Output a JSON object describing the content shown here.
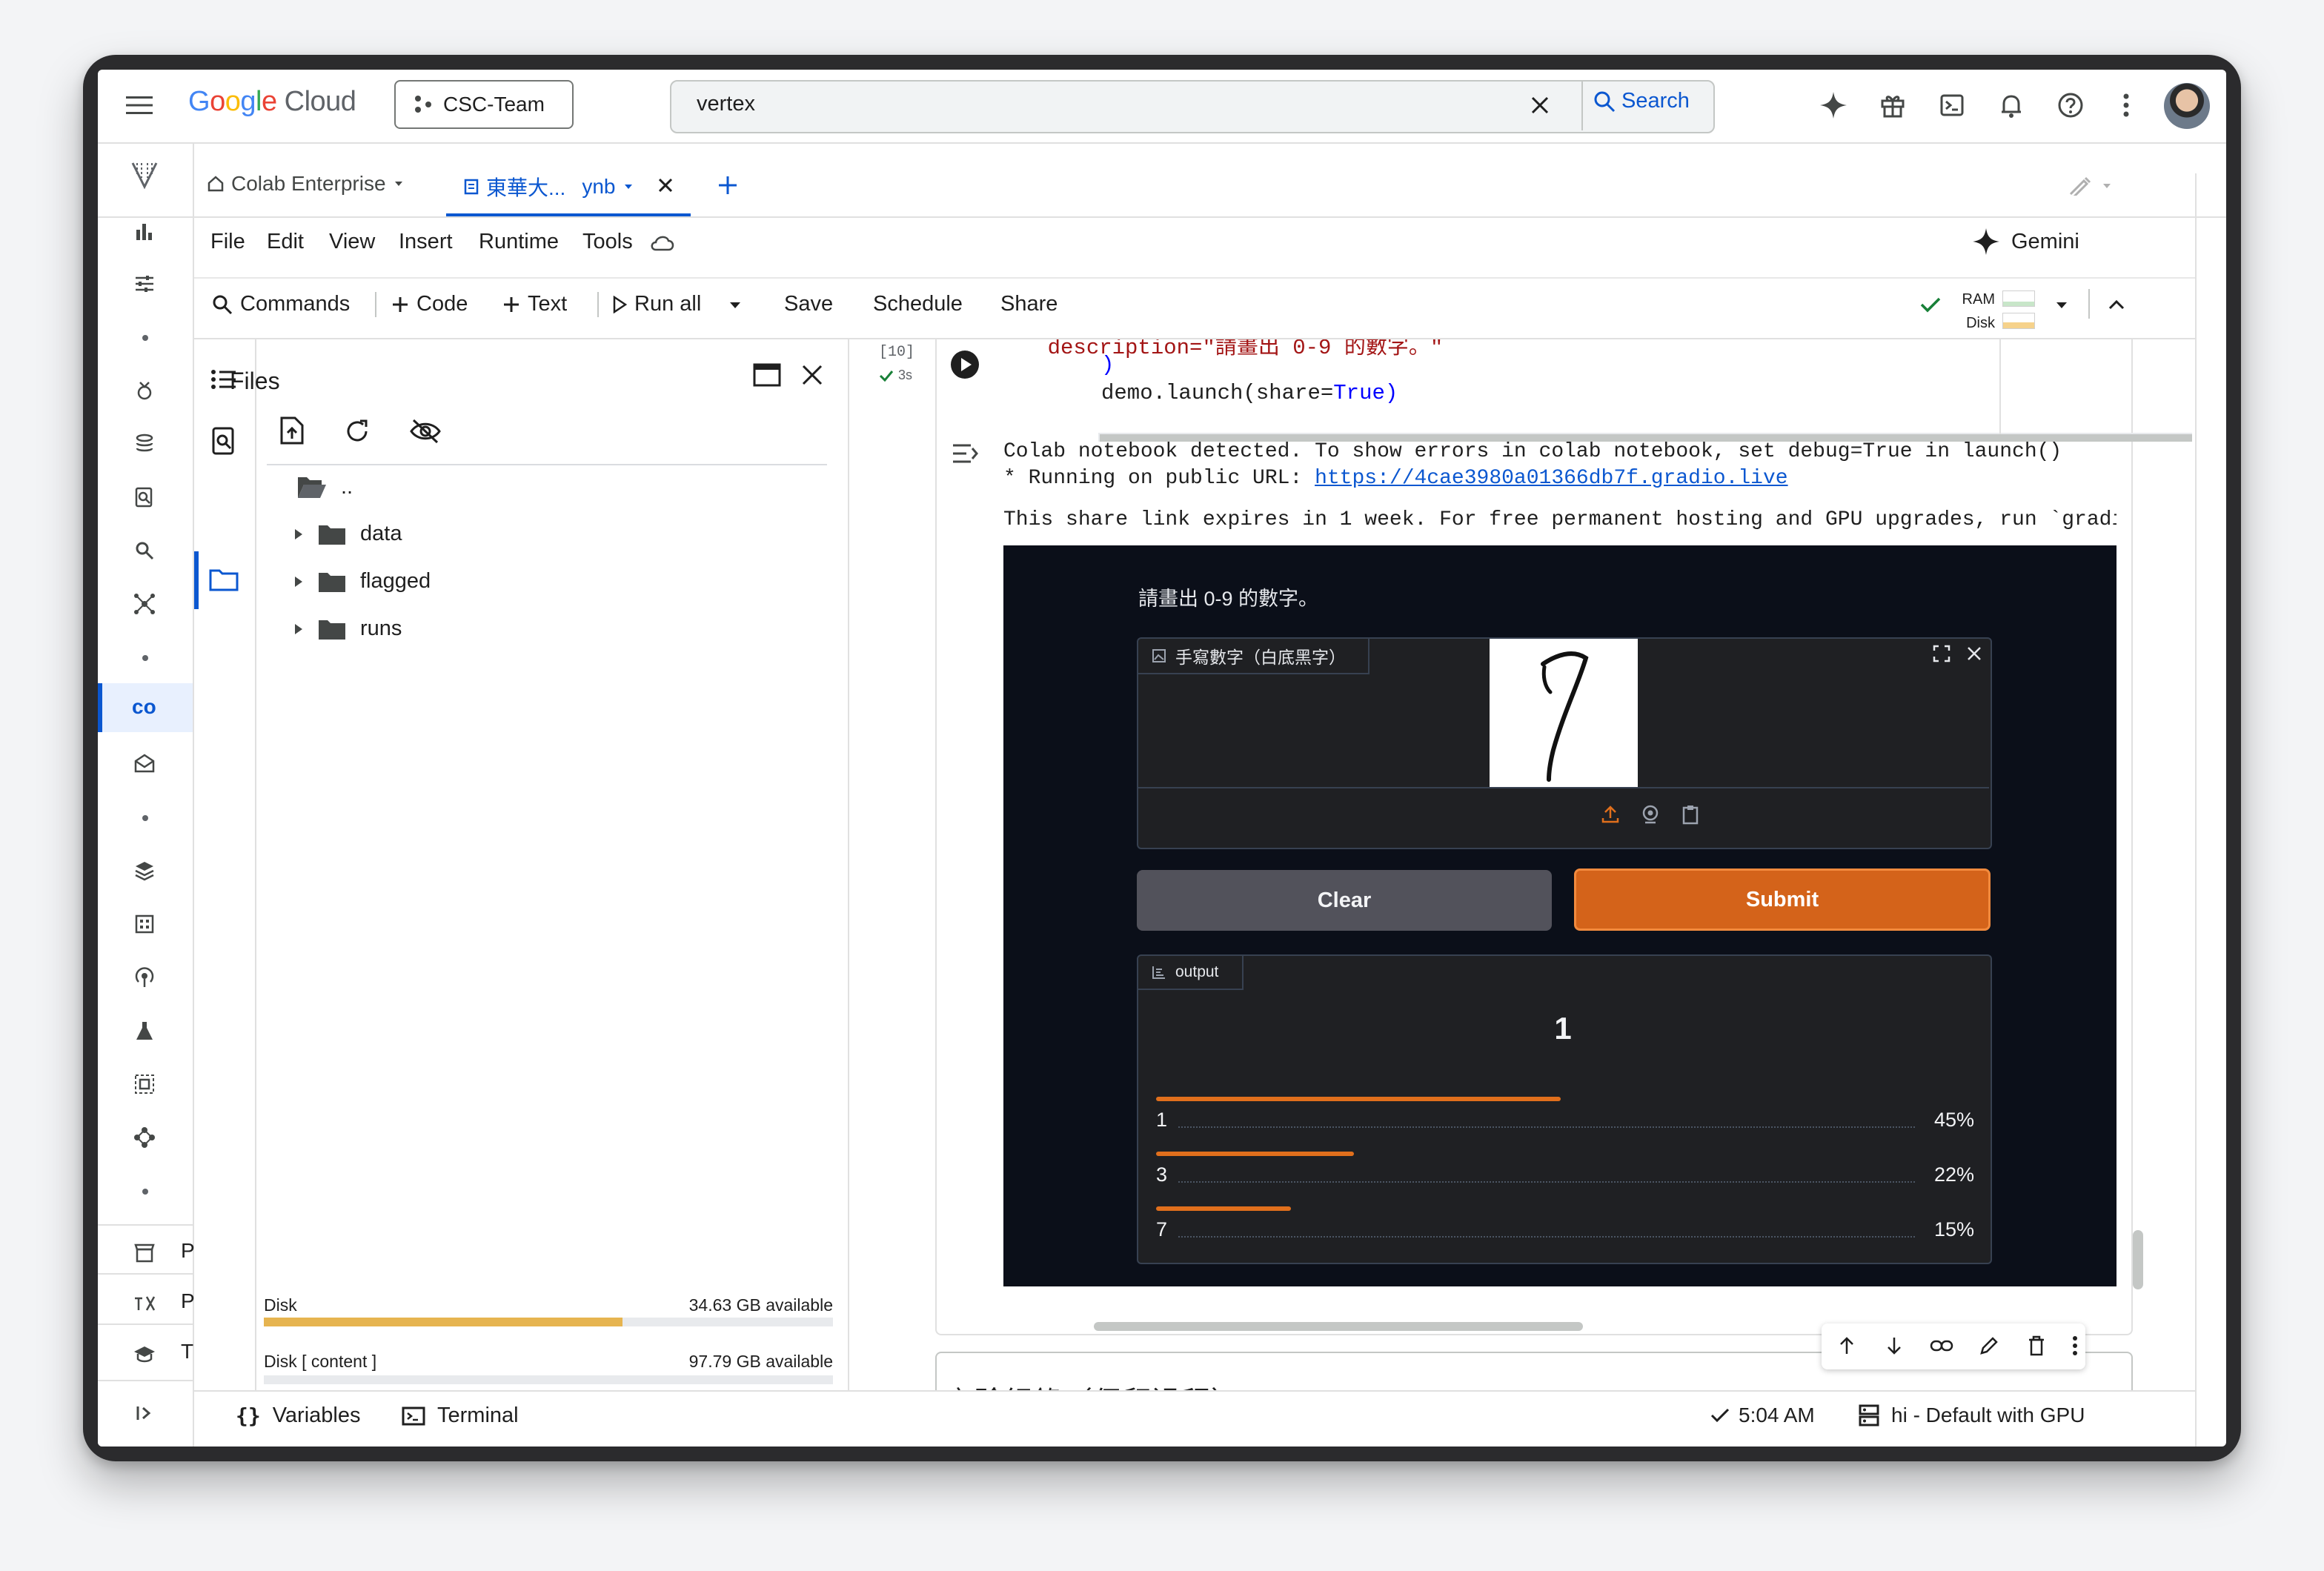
{
  "topbar": {
    "brand": "Google Cloud",
    "project": "CSC-Team",
    "search_value": "vertex",
    "search_button": "Search"
  },
  "tabs": {
    "colab_enterprise": "Colab Enterprise",
    "notebook_tab_prefix": "東華大...",
    "notebook_tab_suffix": "ynb"
  },
  "menu": {
    "items": [
      "File",
      "Edit",
      "View",
      "Insert",
      "Runtime",
      "Tools"
    ],
    "gemini": "Gemini"
  },
  "toolbar": {
    "commands": "Commands",
    "code": "Code",
    "text": "Text",
    "run_all": "Run all",
    "save": "Save",
    "schedule": "Schedule",
    "share": "Share",
    "ram": "RAM",
    "disk": "Disk"
  },
  "files_panel": {
    "title": "Files",
    "entries": [
      "..",
      "data",
      "flagged",
      "runs"
    ],
    "disk_label": "Disk",
    "disk_available": "34.63 GB available",
    "disk_fill": 0.63,
    "content_label": "Disk [ content ]",
    "content_available": "97.79 GB available"
  },
  "cell": {
    "exec_count": "[10]",
    "exec_time": "3s",
    "code_line1": "    description=\"請畫出 0-9 的數字。\"",
    "code_line2": ")",
    "code_line3_a": "demo.launch(share=",
    "code_line3_b": "True",
    "code_line3_c": ")",
    "out_line1": "Colab notebook detected. To show errors in colab notebook, set debug=True in launch()",
    "out_line2_prefix": "* Running on public URL: ",
    "out_url": "https://4cae3980a01366db7f.gradio.live",
    "out_line3": "This share link expires in 1 week. For free permanent hosting and GPU upgrades, run `gradi"
  },
  "gradio": {
    "description": "請畫出 0-9 的數字。",
    "input_label": "手寫數字（白底黑字）",
    "clear": "Clear",
    "submit": "Submit",
    "output_label": "output",
    "prediction": "1",
    "bars": [
      {
        "label": "1",
        "percent": "45%",
        "value": 0.45
      },
      {
        "label": "3",
        "percent": "22%",
        "value": 0.22
      },
      {
        "label": "7",
        "percent": "15%",
        "value": 0.15
      }
    ],
    "accent": "#e06f1c"
  },
  "next_cell_text": "實驗紀錄（保留過程）",
  "status_bar": {
    "variables": "Variables",
    "terminal": "Terminal",
    "time": "5:04 AM",
    "runtime": "hi - Default with GPU"
  },
  "left_rail_partial": [
    "P",
    "P",
    "T"
  ]
}
